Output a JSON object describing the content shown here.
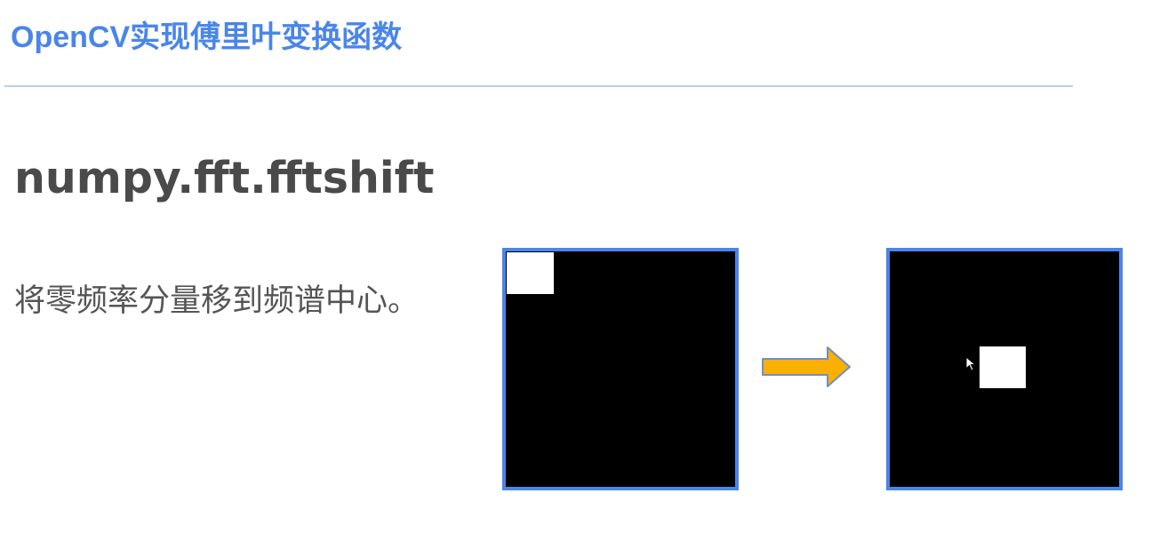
{
  "slide": {
    "header_title": "OpenCV实现傅里叶变换函数",
    "heading": "numpy.fft.fftshift",
    "description": "将零频率分量移到频谱中心。"
  },
  "illustration": {
    "accent_color": "#4a86e8",
    "arrow_color": "#f9b000",
    "arrow_outline_color": "#6f8fc9",
    "icons": [
      "right-arrow-icon",
      "mouse-pointer-icon"
    ]
  }
}
